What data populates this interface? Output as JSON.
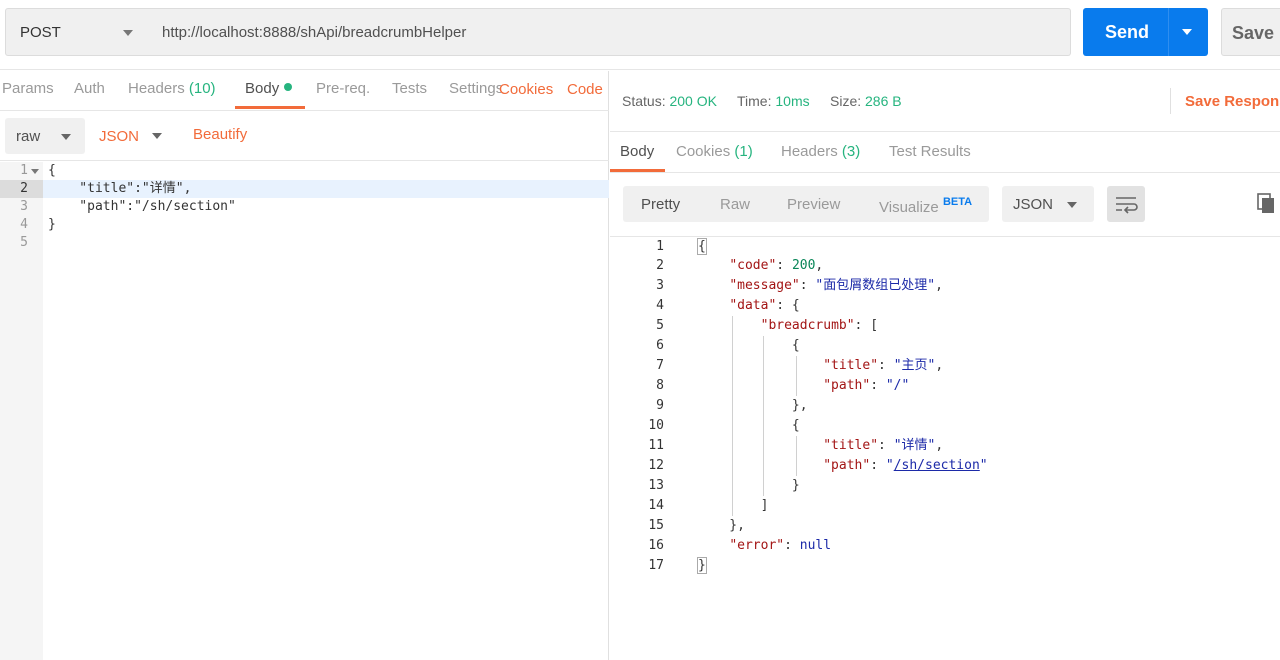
{
  "request": {
    "method": "POST",
    "url": "http://localhost:8888/shApi/breadcrumbHelper",
    "send_label": "Send",
    "save_label": "Save"
  },
  "request_tabs": {
    "params": "Params",
    "auth": "Auth",
    "headers": "Headers",
    "headers_count": "(10)",
    "body": "Body",
    "prereq": "Pre-req.",
    "tests": "Tests",
    "settings": "Settings",
    "cookies": "Cookies",
    "code": "Code"
  },
  "body_options": {
    "mode": "raw",
    "format": "JSON",
    "beautify": "Beautify"
  },
  "editor": {
    "line_numbers": [
      "1",
      "2",
      "3",
      "4",
      "5"
    ],
    "lines": [
      "{",
      "    \"title\":\"详情\",",
      "    \"path\":\"/sh/section\"",
      "}",
      ""
    ]
  },
  "response_status": {
    "status_label": "Status:",
    "status_value": "200 OK",
    "time_label": "Time:",
    "time_value": "10ms",
    "size_label": "Size:",
    "size_value": "286 B",
    "save_response": "Save Response"
  },
  "response_tabs": {
    "body": "Body",
    "cookies": "Cookies",
    "cookies_count": "(1)",
    "headers": "Headers",
    "headers_count": "(3)",
    "test_results": "Test Results"
  },
  "view_options": {
    "pretty": "Pretty",
    "raw": "Raw",
    "preview": "Preview",
    "visualize": "Visualize",
    "beta": "BETA",
    "format": "JSON"
  },
  "response_body": {
    "line_numbers": [
      "1",
      "2",
      "3",
      "4",
      "5",
      "6",
      "7",
      "8",
      "9",
      "10",
      "11",
      "12",
      "13",
      "14",
      "15",
      "16",
      "17"
    ],
    "code_key": "\"code\"",
    "code_val": "200",
    "message_key": "\"message\"",
    "message_val": "\"面包屑数组已处理\"",
    "data_key": "\"data\"",
    "breadcrumb_key": "\"breadcrumb\"",
    "title_key": "\"title\"",
    "path_key": "\"path\"",
    "item1_title": "\"主页\"",
    "item1_path": "\"/\"",
    "item2_title": "\"详情\"",
    "item2_path_q": "\"",
    "item2_path_link": "/sh/section",
    "error_key": "\"error\"",
    "error_val": "null"
  }
}
